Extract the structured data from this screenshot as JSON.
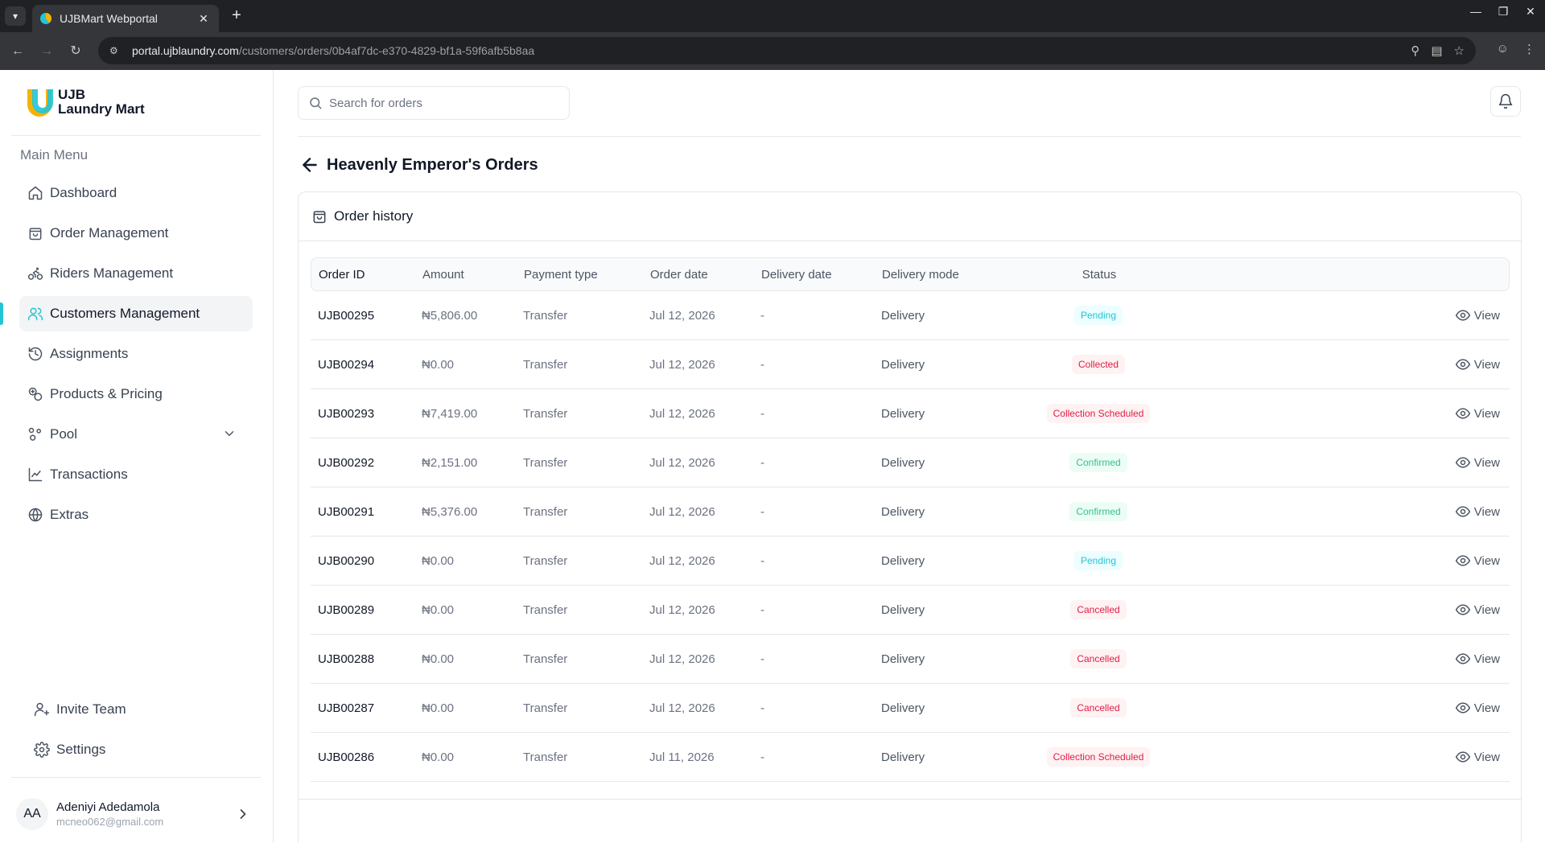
{
  "browser": {
    "tab_title": "UJBMart Webportal",
    "url_host": "portal.ujblaundry.com",
    "url_path": "/customers/orders/0b4af7dc-e370-4829-bf1a-59f6afb5b8aa"
  },
  "brand": {
    "line1": "UJB",
    "line2": "Laundry Mart",
    "accent": "#22c5d6",
    "secondary": "#f5b301"
  },
  "sidebar": {
    "menu_title": "Main Menu",
    "items": [
      {
        "label": "Dashboard",
        "icon": "home-icon"
      },
      {
        "label": "Order Management",
        "icon": "shopping-bag-icon"
      },
      {
        "label": "Riders Management",
        "icon": "bike-icon"
      },
      {
        "label": "Customers Management",
        "icon": "users-icon",
        "active": true
      },
      {
        "label": "Assignments",
        "icon": "history-icon"
      },
      {
        "label": "Products & Pricing",
        "icon": "tags-icon"
      },
      {
        "label": "Pool",
        "icon": "pool-icon"
      },
      {
        "label": "Transactions",
        "icon": "chart-line-icon"
      },
      {
        "label": "Extras",
        "icon": "globe-icon"
      }
    ],
    "bottom_items": [
      {
        "label": "Invite Team",
        "icon": "user-plus-icon"
      },
      {
        "label": "Settings",
        "icon": "gear-icon"
      }
    ],
    "user": {
      "initials": "AA",
      "name": "Adeniyi Adedamola",
      "email": "mcneo062@gmail.com"
    }
  },
  "header": {
    "search_placeholder": "Search for orders"
  },
  "page": {
    "title": "Heavenly Emperor's Orders",
    "card_title": "Order history"
  },
  "table": {
    "columns": [
      "Order ID",
      "Amount",
      "Payment type",
      "Order date",
      "Delivery date",
      "Delivery mode",
      "Status"
    ],
    "view_label": "View",
    "rows": [
      {
        "id": "UJB00295",
        "amount": "₦5,806.00",
        "payment": "Transfer",
        "order_date": "Jul 12, 2026",
        "delivery_date": "-",
        "mode": "Delivery",
        "status": "Pending",
        "status_type": "pending"
      },
      {
        "id": "UJB00294",
        "amount": "₦0.00",
        "payment": "Transfer",
        "order_date": "Jul 12, 2026",
        "delivery_date": "-",
        "mode": "Delivery",
        "status": "Collected",
        "status_type": "danger"
      },
      {
        "id": "UJB00293",
        "amount": "₦7,419.00",
        "payment": "Transfer",
        "order_date": "Jul 12, 2026",
        "delivery_date": "-",
        "mode": "Delivery",
        "status": "Collection Scheduled",
        "status_type": "danger"
      },
      {
        "id": "UJB00292",
        "amount": "₦2,151.00",
        "payment": "Transfer",
        "order_date": "Jul 12, 2026",
        "delivery_date": "-",
        "mode": "Delivery",
        "status": "Confirmed",
        "status_type": "success"
      },
      {
        "id": "UJB00291",
        "amount": "₦5,376.00",
        "payment": "Transfer",
        "order_date": "Jul 12, 2026",
        "delivery_date": "-",
        "mode": "Delivery",
        "status": "Confirmed",
        "status_type": "success"
      },
      {
        "id": "UJB00290",
        "amount": "₦0.00",
        "payment": "Transfer",
        "order_date": "Jul 12, 2026",
        "delivery_date": "-",
        "mode": "Delivery",
        "status": "Pending",
        "status_type": "pending"
      },
      {
        "id": "UJB00289",
        "amount": "₦0.00",
        "payment": "Transfer",
        "order_date": "Jul 12, 2026",
        "delivery_date": "-",
        "mode": "Delivery",
        "status": "Cancelled",
        "status_type": "danger"
      },
      {
        "id": "UJB00288",
        "amount": "₦0.00",
        "payment": "Transfer",
        "order_date": "Jul 12, 2026",
        "delivery_date": "-",
        "mode": "Delivery",
        "status": "Cancelled",
        "status_type": "danger"
      },
      {
        "id": "UJB00287",
        "amount": "₦0.00",
        "payment": "Transfer",
        "order_date": "Jul 12, 2026",
        "delivery_date": "-",
        "mode": "Delivery",
        "status": "Cancelled",
        "status_type": "danger"
      },
      {
        "id": "UJB00286",
        "amount": "₦0.00",
        "payment": "Transfer",
        "order_date": "Jul 11, 2026",
        "delivery_date": "-",
        "mode": "Delivery",
        "status": "Collection Scheduled",
        "status_type": "danger"
      }
    ]
  }
}
